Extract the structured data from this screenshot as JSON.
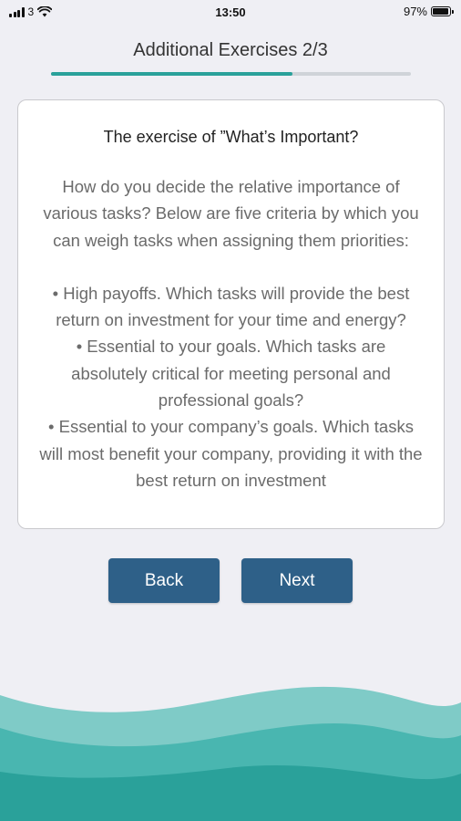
{
  "status_bar": {
    "carrier": "3",
    "time": "13:50",
    "battery_percent": "97%",
    "battery_level": 0.97,
    "icons": [
      "signal-icon",
      "wifi-icon",
      "battery-icon"
    ]
  },
  "header": {
    "title": "Additional Exercises 2/3",
    "progress": 0.67
  },
  "card": {
    "title": "The exercise of ”What’s Important?",
    "intro": "How do you decide the relative importance of various tasks? Below are five criteria by which you can weigh tasks when assigning them priorities:",
    "bullets": [
      "• High payoffs. Which tasks will provide the best return on investment for your time and energy?",
      "• Essential to your goals. Which tasks are absolutely critical for meeting personal and professional goals?",
      "• Essential to your company’s goals. Which tasks will most benefit your company, providing it with the best return on investment"
    ]
  },
  "buttons": {
    "back_label": "Back",
    "next_label": "Next"
  },
  "colors": {
    "background": "#efeff4",
    "accent": "#2aa19a",
    "button": "#2e6088",
    "wave_light": "#7fcbc7",
    "wave_mid": "#49b6b0",
    "wave_dark": "#2aa19a"
  }
}
